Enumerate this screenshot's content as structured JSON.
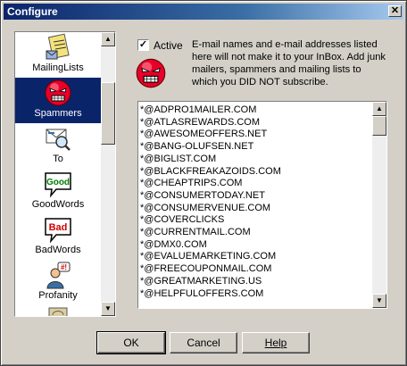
{
  "window": {
    "title": "Configure",
    "close_glyph": "✕"
  },
  "sidebar": {
    "items": [
      {
        "label": "MailingLists",
        "icon": "mailing-lists-icon",
        "selected": false
      },
      {
        "label": "Spammers",
        "icon": "angry-face-icon",
        "selected": true
      },
      {
        "label": "To",
        "icon": "to-envelope-icon",
        "selected": false
      },
      {
        "label": "GoodWords",
        "icon": "good-speech-icon",
        "badge": "Good",
        "selected": false
      },
      {
        "label": "BadWords",
        "icon": "bad-speech-icon",
        "badge": "Bad",
        "selected": false
      },
      {
        "label": "Profanity",
        "icon": "profanity-person-icon",
        "selected": false
      }
    ]
  },
  "panel": {
    "active_label": "Active",
    "active_checked": true,
    "description": "E-mail names and e-mail addresses listed here will not make it to your InBox. Add junk mailers, spammers and mailing lists to which you DID NOT subscribe."
  },
  "spam_list": [
    "*@ADPRO1MAILER.COM",
    "*@ATLASREWARDS.COM",
    "*@AWESOMEOFFERS.NET",
    "*@BANG-OLUFSEN.NET",
    "*@BIGLIST.COM",
    "*@BLACKFREAKAZOIDS.COM",
    "*@CHEAPTRIPS.COM",
    "*@CONSUMERTODAY.NET",
    "*@CONSUMERVENUE.COM",
    "*@COVERCLICKS",
    "*@CURRENTMAIL.COM",
    "*@DMX0.COM",
    "*@EVALUEMARKETING.COM",
    "*@FREECOUPONMAIL.COM",
    "*@GREATMARKETING.US",
    "*@HELPFULOFFERS.COM"
  ],
  "buttons": {
    "ok": "OK",
    "cancel": "Cancel",
    "help": "Help"
  },
  "colors": {
    "titlebar": "#0a246a",
    "selection": "#0a246a",
    "face": "#d4d0c8",
    "angry_red": "#e8002a"
  }
}
